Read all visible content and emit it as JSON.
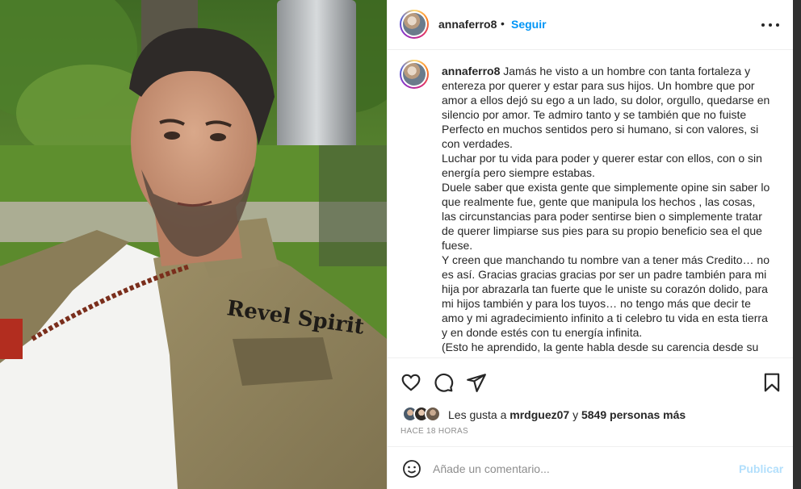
{
  "post": {
    "username": "annaferro8",
    "dot": "•",
    "follow_label": "Seguir",
    "more_icon": "more-horizontal-icon"
  },
  "caption": {
    "username": "annaferro8",
    "paragraphs": [
      "Jamás he visto a un hombre con tanta fortaleza y entereza por querer y estar para sus hijos. Un hombre que por amor a ellos dejó su ego a un lado, su dolor, orgullo, quedarse en silencio por amor. Te admiro tanto y se también que no fuiste Perfecto en muchos sentidos pero si humano, si con valores, si con verdades.",
      "Luchar por tu vida para poder y querer estar con ellos, con o sin energía pero siempre estabas.",
      "Duele saber que exista gente que simplemente opine sin saber lo que realmente fue, gente que manipula los hechos , las cosas, las circunstancias para poder sentirse bien o simplemente tratar de querer limpiarse sus pies para su propio beneficio sea el que fuese.",
      "Y creen que manchando tu nombre van a tener más Credito… no es así. Gracias gracias gracias por ser un padre también para mi hija por abrazarla tan fuerte que le uniste su corazón dolido, para mi hijos también y para los tuyos… no tengo más que decir te amo y mi agradecimiento infinito a ti celebro tu vida en esta tierra y en donde estés con tu energía infinita.",
      "(Esto he aprendido, la gente habla desde su carencia desde su"
    ]
  },
  "actions": {
    "like_icon": "heart-icon",
    "comment_icon": "comment-icon",
    "share_icon": "send-icon",
    "save_icon": "bookmark-icon"
  },
  "likes": {
    "prefix": "Les gusta a ",
    "user": "mrdguez07",
    "middle": " y ",
    "count": "5849 personas más"
  },
  "timestamp": "HACE 18 HORAS",
  "comment": {
    "placeholder": "Añade un comentario...",
    "publish_label": "Publicar",
    "emoji_icon": "smiley-icon"
  },
  "photo": {
    "jacket_text": "Revel Spirit"
  },
  "colors": {
    "accent": "#0095f6",
    "publish_disabled": "#b2dffc",
    "text": "#262626",
    "muted": "#8e8e8e",
    "border": "#efefef"
  }
}
